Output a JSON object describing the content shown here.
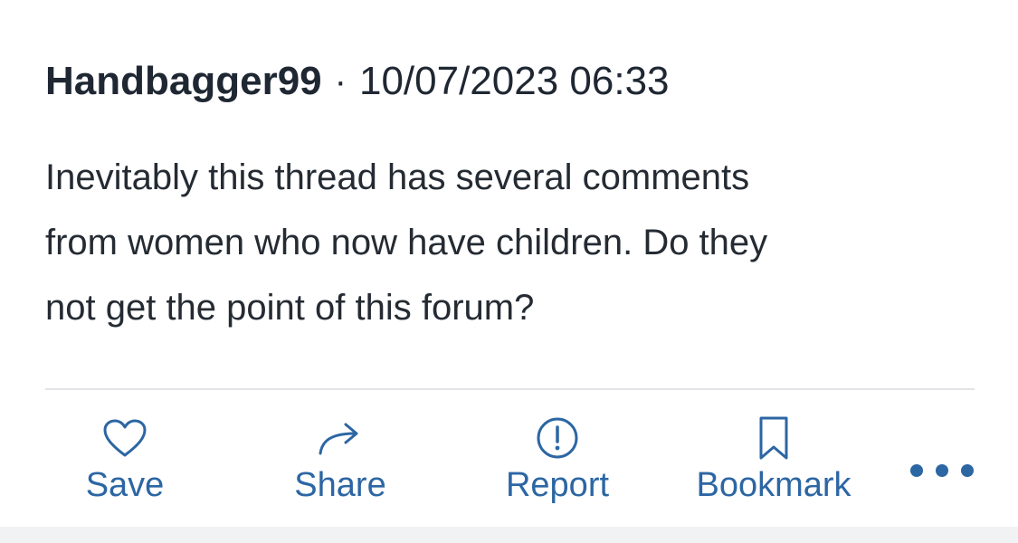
{
  "post": {
    "author": "Handbagger99",
    "separator": "·",
    "timestamp": "10/07/2023 06:33",
    "body_lines": [
      "Inevitably this thread has several comments",
      "from women who now have children. Do they",
      "not get the point of this forum?"
    ]
  },
  "actions": {
    "save": {
      "label": "Save",
      "icon": "heart-icon"
    },
    "share": {
      "label": "Share",
      "icon": "arrow-share-icon"
    },
    "report": {
      "label": "Report",
      "icon": "exclamation-circle-icon"
    },
    "bookmark": {
      "label": "Bookmark",
      "icon": "bookmark-icon"
    },
    "more": {
      "icon": "more-dots-icon"
    }
  },
  "colors": {
    "text": "#1f2733",
    "accent": "#2c66a3",
    "divider": "#e1e3e6",
    "footer_strip": "#f1f2f4"
  }
}
